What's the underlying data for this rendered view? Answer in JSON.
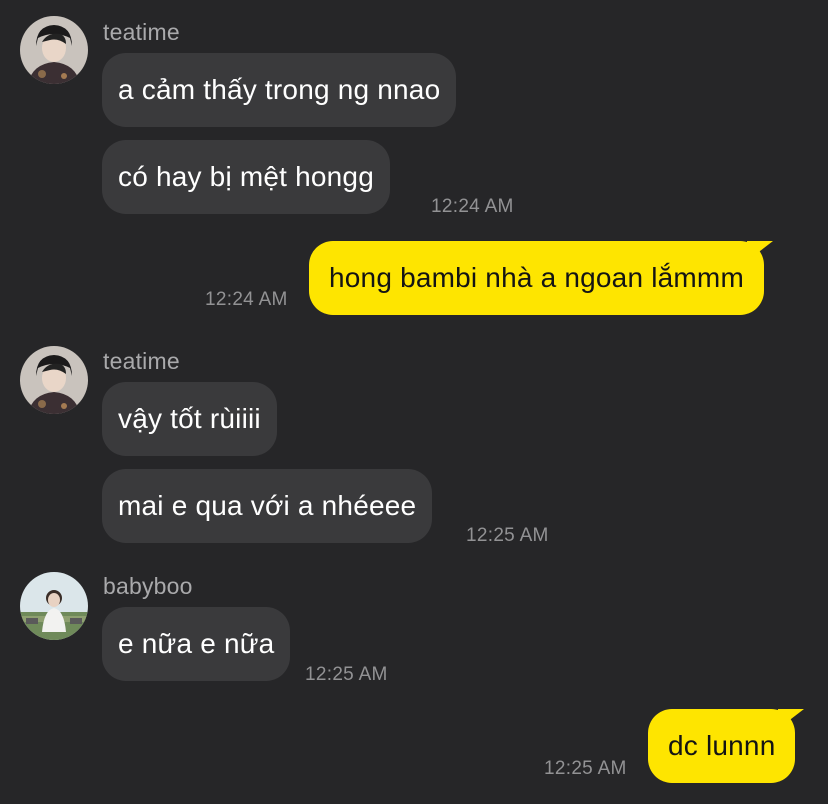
{
  "colors": {
    "background": "#262628",
    "incoming_bubble": "#3a3a3c",
    "outgoing_bubble": "#fee500",
    "sender_name": "#a9a9ab",
    "timestamp": "#929294"
  },
  "messages": [
    {
      "sender": "teatime",
      "avatar_icon": "profile-photo-teatime",
      "bubbles": [
        "a cảm thấy trong ng nnao",
        "có hay bị mệt hongg"
      ],
      "time": "12:24 AM"
    },
    {
      "sender": "me",
      "bubbles": [
        "hong bambi nhà a ngoan lắmmm"
      ],
      "time": "12:24 AM"
    },
    {
      "sender": "teatime",
      "avatar_icon": "profile-photo-teatime",
      "bubbles": [
        "vậy tốt rùiiii",
        "mai e qua với a nhéeee"
      ],
      "time": "12:25 AM"
    },
    {
      "sender": "babyboo",
      "avatar_icon": "profile-photo-babyboo",
      "bubbles": [
        "e nữa e nữa"
      ],
      "time": "12:25 AM"
    },
    {
      "sender": "me",
      "bubbles": [
        "dc lunnn"
      ],
      "time": "12:25 AM"
    }
  ]
}
